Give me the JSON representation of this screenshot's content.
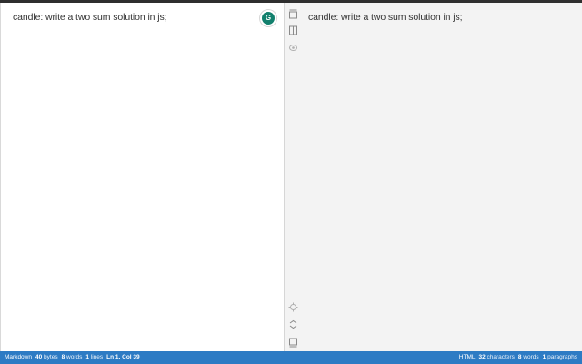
{
  "editor": {
    "text": "candle: write a two sum solution in js;",
    "grammarly_icon": "G"
  },
  "preview": {
    "text": "candle: write a two sum solution in js;"
  },
  "toolbar": {
    "icons": [
      "toggle-top-icon",
      "split-view-icon",
      "eye-icon",
      "sync-scroll-icon",
      "fullscreen-icon",
      "toggle-bottom-icon"
    ]
  },
  "status": {
    "mode": "Markdown",
    "bytes": "40",
    "bytes_label": "bytes",
    "words": "8",
    "words_label": "words",
    "lines": "1",
    "lines_label": "lines",
    "cursor": "Ln 1, Col 39",
    "right_mode": "HTML",
    "characters": "32",
    "characters_label": "characters",
    "right_words": "8",
    "right_words_label": "words",
    "paragraphs": "1",
    "paragraphs_label": "paragraphs"
  },
  "colors": {
    "statusbar": "#2d7bc4",
    "grammarly": "#12806d",
    "preview_bg": "#f3f3f3"
  }
}
